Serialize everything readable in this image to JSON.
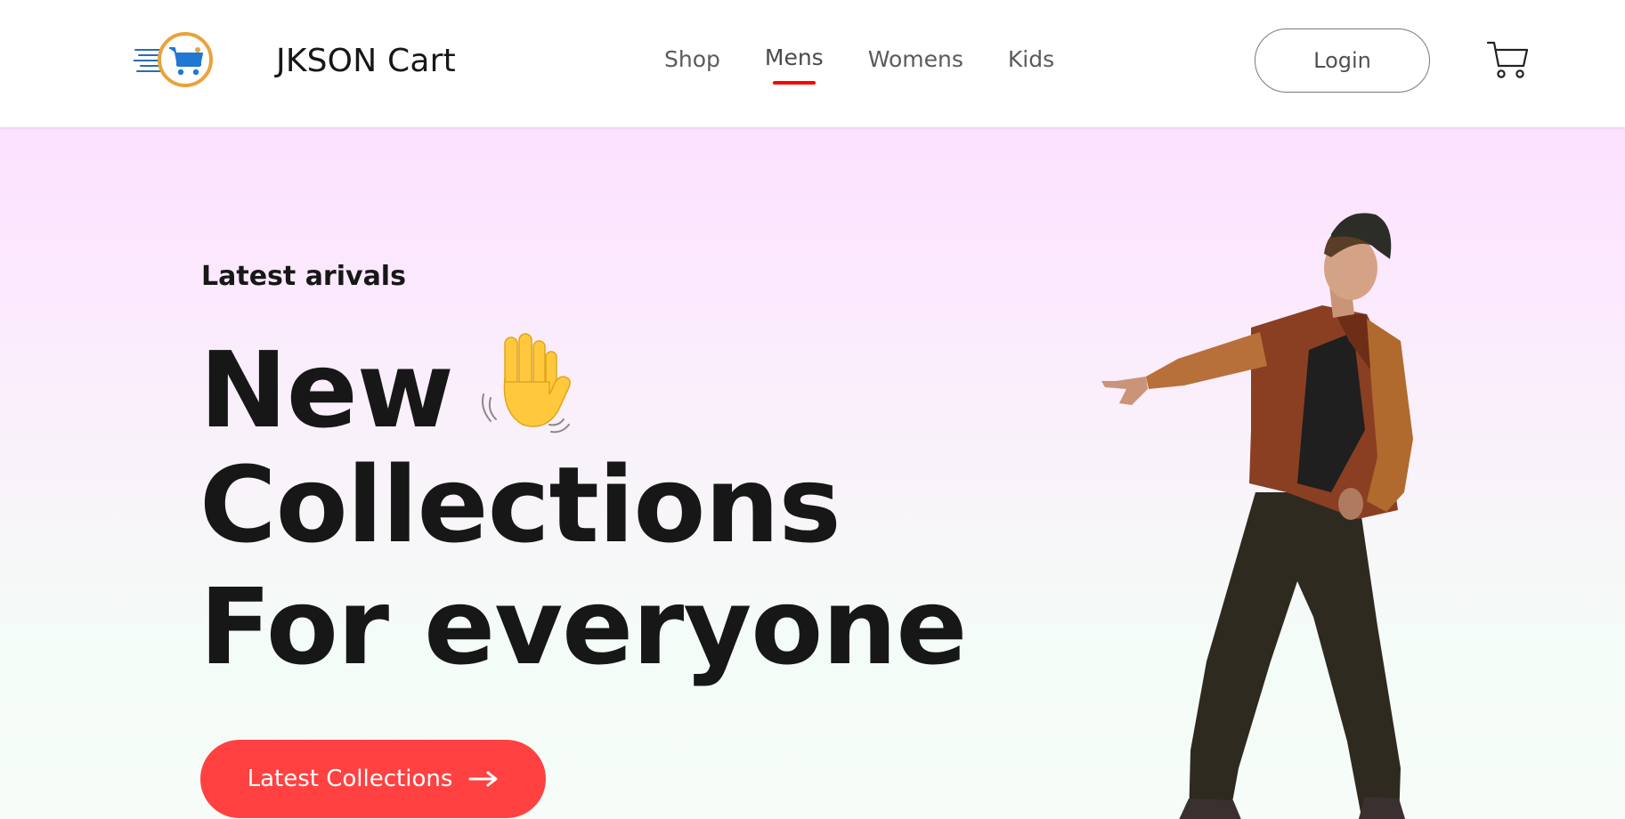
{
  "brand": {
    "name": "JKSON Cart",
    "logo_icon": "shopping-cart-logo-icon",
    "accent": "#e8a33c"
  },
  "nav": {
    "items": [
      {
        "label": "Shop",
        "active": false
      },
      {
        "label": "Mens",
        "active": true
      },
      {
        "label": "Womens",
        "active": false
      },
      {
        "label": "Kids",
        "active": false
      }
    ],
    "active_underline_color": "#ff0000"
  },
  "actions": {
    "login_label": "Login",
    "cart_icon": "cart-icon"
  },
  "hero": {
    "subtitle": "Latest arivals",
    "title_line1": "New",
    "title_line2": "Collections",
    "title_line3": "For everyone",
    "emoji": "waving-hand-icon",
    "cta_label": "Latest Collections",
    "cta_icon": "arrow-right-icon",
    "cta_color": "#ff4141",
    "image": "male-model-jacket-image",
    "gradient_top": "#fde1ff",
    "gradient_bottom": "#f6fdf9"
  }
}
